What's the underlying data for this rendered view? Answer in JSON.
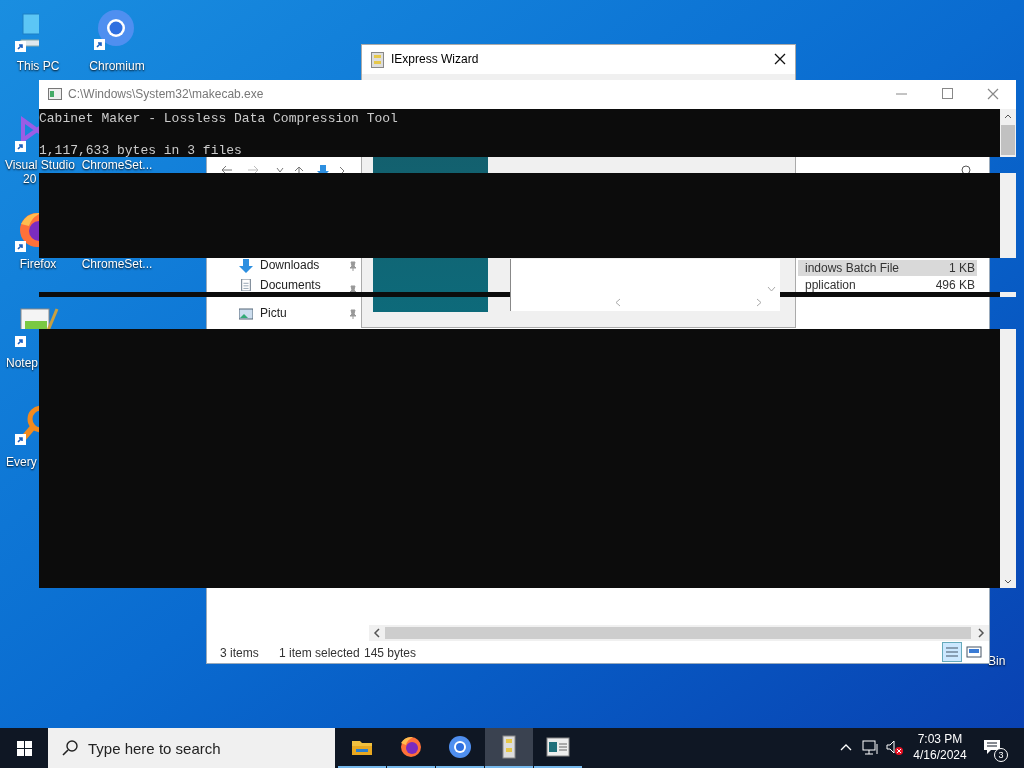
{
  "desktop_icons": [
    {
      "label": "This PC",
      "kind": "pc"
    },
    {
      "label": "Chromium",
      "kind": "chromium"
    },
    {
      "label": "Visual Studio",
      "label_2": "20",
      "kind": "vs"
    },
    {
      "label": "ChromeSet...",
      "kind": "hidden"
    },
    {
      "label": "Firefox",
      "kind": "firefox"
    },
    {
      "label": "ChromeSet...",
      "kind": "hidden"
    },
    {
      "label": "Notep",
      "kind": "notepad"
    },
    {
      "label": "Every",
      "kind": "everything"
    },
    {
      "label": "Bin",
      "kind": "hidden"
    }
  ],
  "explorer": {
    "sidebar": [
      {
        "label": "Downloads",
        "kind": "downloads"
      },
      {
        "label": "Documents",
        "kind": "documents"
      },
      {
        "label": "Pictu",
        "kind": "pictures"
      }
    ],
    "files": [
      {
        "type": "indows Batch File",
        "size": "1 KB",
        "selected": true
      },
      {
        "type": "pplication",
        "size": "496 KB",
        "selected": false
      }
    ],
    "status": {
      "items": "3 items",
      "selection": "1 item selected",
      "size": "145 bytes"
    }
  },
  "wizard": {
    "title": "IExpress Wizard"
  },
  "console": {
    "title": "C:\\Windows\\System32\\makecab.exe",
    "header": "Cabinet Maker - Lossless Data Compression Tool",
    "result": "1,117,633 bytes in 3 files"
  },
  "taskbar": {
    "search_placeholder": "Type here to search",
    "apps": [
      {
        "kind": "explorer",
        "selected": false
      },
      {
        "kind": "firefox",
        "selected": false
      },
      {
        "kind": "chromium",
        "selected": false
      },
      {
        "kind": "iexpress",
        "selected": true
      },
      {
        "kind": "cabinet",
        "selected": false
      }
    ],
    "time": "7:03 PM",
    "date": "4/16/2024",
    "notifications": "3"
  }
}
